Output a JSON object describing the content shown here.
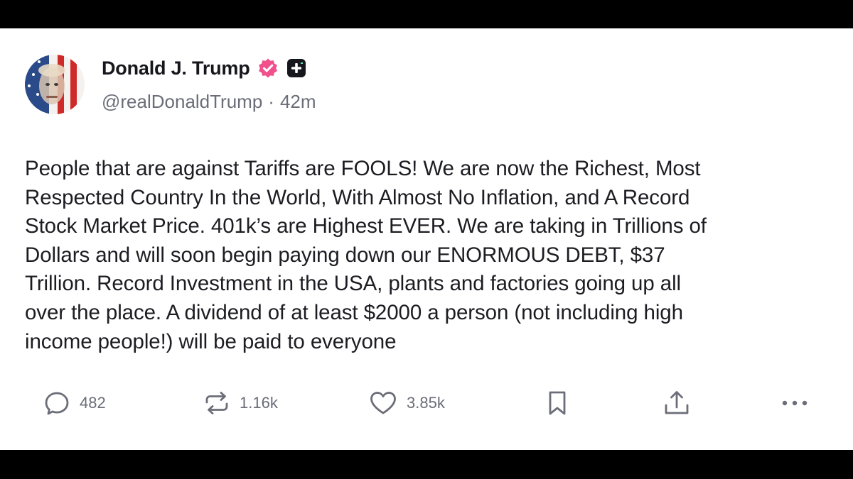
{
  "post": {
    "author": {
      "display_name": "Donald J. Trump",
      "handle": "@realDonaldTrump",
      "separator": "·",
      "time_ago": "42m",
      "avatar_icon": "flag-portrait-avatar",
      "verified_icon": "verified-badge-icon",
      "verified_color": "#f0508c",
      "plus_badge_icon": "plus-square-icon"
    },
    "body": "People that are against Tariffs are FOOLS! We are now the Richest, Most\nRespected Country In the World, With Almost No Inflation, and A Record\nStock Market Price. 401k’s are Highest EVER. We are taking in Trillions of\nDollars and will soon begin paying down our ENORMOUS DEBT, $37\nTrillion. Record Investment in the USA, plants and factories going up all\nover the place. A dividend of at least $2000 a person (not including high\nincome people!) will be paid to everyone",
    "actions": {
      "replies": {
        "icon": "reply-bubble-icon",
        "count": "482"
      },
      "retruths": {
        "icon": "repost-icon",
        "count": "1.16k"
      },
      "likes": {
        "icon": "heart-icon",
        "count": "3.85k"
      },
      "bookmark": {
        "icon": "bookmark-icon"
      },
      "share": {
        "icon": "share-upload-icon"
      },
      "more": {
        "icon": "more-dots-icon"
      }
    }
  }
}
